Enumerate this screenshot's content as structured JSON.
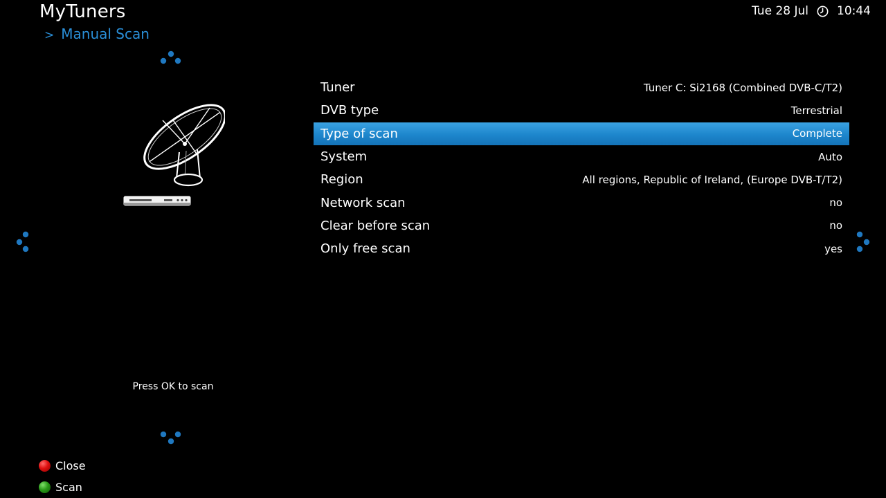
{
  "header": {
    "title": "MyTuners",
    "breadcrumb_sep": ">",
    "breadcrumb": "Manual Scan",
    "date": "Tue 28 Jul",
    "time": "10:44",
    "clock_icon": "clock-icon"
  },
  "left_panel": {
    "image": "satellite-dish-receiver-icon",
    "hint": "Press OK to scan"
  },
  "menu": {
    "selected_index": 2,
    "items": [
      {
        "label": "Tuner",
        "value": "Tuner C: Si2168 (Combined DVB-C/T2)"
      },
      {
        "label": "DVB type",
        "value": "Terrestrial"
      },
      {
        "label": "Type of scan",
        "value": "Complete"
      },
      {
        "label": "System",
        "value": "Auto"
      },
      {
        "label": "Region",
        "value": "All regions, Republic of Ireland, (Europe DVB-T/T2)"
      },
      {
        "label": "Network scan",
        "value": "no"
      },
      {
        "label": "Clear before scan",
        "value": "no"
      },
      {
        "label": "Only free scan",
        "value": "yes"
      }
    ]
  },
  "color_buttons": [
    {
      "label": "Close",
      "color": "#e01010",
      "icon": "red-button-icon"
    },
    {
      "label": "Scan",
      "color": "#2a9a18",
      "icon": "green-button-icon"
    }
  ],
  "colors": {
    "accent": "#2a8fd8",
    "selection": "#1d86cc",
    "background": "#000000",
    "text": "#ffffff"
  }
}
